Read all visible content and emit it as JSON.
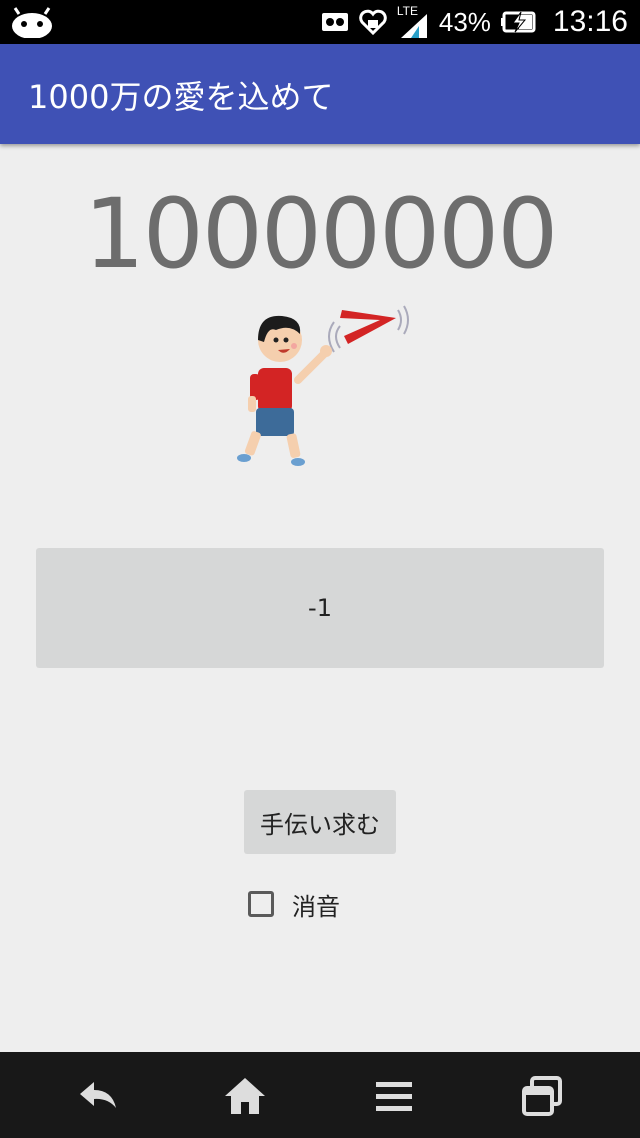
{
  "status_bar": {
    "network_label": "LTE",
    "battery_percent": "43%",
    "time": "13:16"
  },
  "app_bar": {
    "title": "1000万の愛を込めて"
  },
  "main": {
    "counter": "10000000",
    "minus_button_label": "-1",
    "help_button_label": "手伝い求む",
    "mute_checkbox": {
      "label": "消音",
      "checked": false
    }
  },
  "icons": {
    "status": [
      "android-icon",
      "voicemail-icon",
      "heart-shield-icon",
      "signal-icon",
      "battery-charging-icon"
    ],
    "nav": [
      "back-icon",
      "home-icon",
      "menu-icon",
      "recent-apps-icon"
    ]
  },
  "colors": {
    "app_bar": "#3f51b5",
    "background": "#eeeeee",
    "counter_text": "#6d6d6d",
    "button": "#d6d7d7"
  }
}
